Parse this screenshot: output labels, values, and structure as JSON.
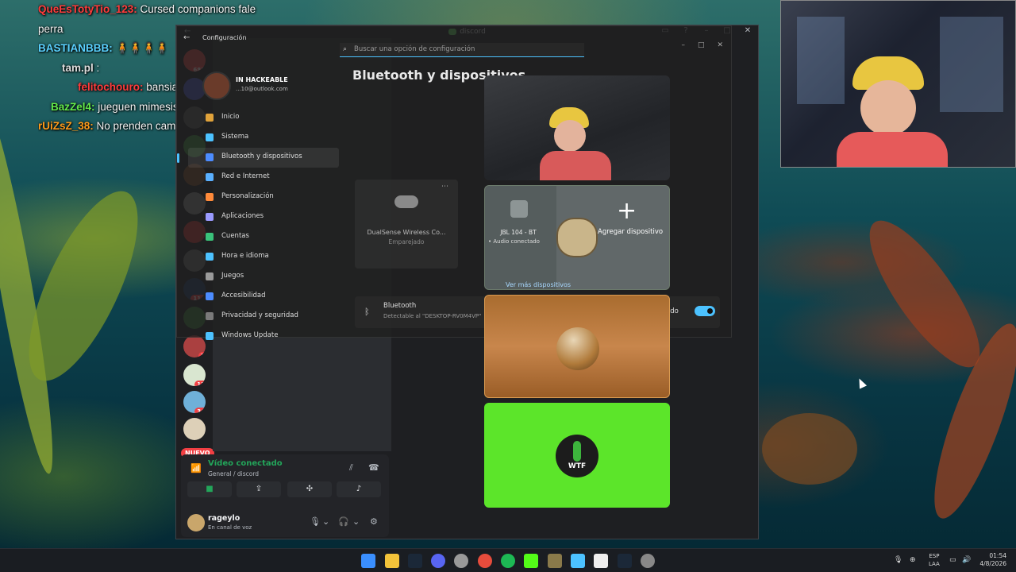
{
  "stream_chat": [
    {
      "user": "QueEsTotyTio_123:",
      "text": " Cursed companions fale",
      "color": "#ff3b3b"
    },
    {
      "user": "",
      "text": "perra",
      "color": "#ffffff"
    },
    {
      "user": "BASTIANBBB:",
      "text": " 🧍🧍🧍🧍",
      "color": "#5ad1ff"
    },
    {
      "user": "tam.pl",
      "text": " :",
      "color": "#ffffff"
    },
    {
      "user": "felitochouro:",
      "text": " bansiaaann",
      "color": "#ff3b3b"
    },
    {
      "user": "BazZel4:",
      "text": " jueguen mimesis",
      "color": "#63e94a"
    },
    {
      "user": "rUiZsZ_38:",
      "text": " No prenden cam",
      "color": "#ff9a1a"
    }
  ],
  "discord": {
    "title": "discord",
    "guild_badges": [
      "683",
      "114",
      "2",
      "11",
      "34"
    ],
    "new_badge": "NUEVO",
    "voice_status": {
      "title": "Vídeo conectado",
      "subtitle": "General / discord"
    },
    "user": {
      "name": "rageylo",
      "status": "En canal de voz"
    }
  },
  "settings": {
    "header": "Configuración",
    "search_placeholder": "Buscar una opción de configuración",
    "profile_name": "IN HACKEABLE",
    "profile_email": "...10@outlook.com",
    "nav": [
      {
        "label": "Inicio",
        "color": "#e0a23a"
      },
      {
        "label": "Sistema",
        "color": "#4cc2ff"
      },
      {
        "label": "Bluetooth y dispositivos",
        "color": "#4c8cff",
        "active": true
      },
      {
        "label": "Red e Internet",
        "color": "#5ab0ff"
      },
      {
        "label": "Personalización",
        "color": "#ff8a3a"
      },
      {
        "label": "Aplicaciones",
        "color": "#9a9aff"
      },
      {
        "label": "Cuentas",
        "color": "#3ac27a"
      },
      {
        "label": "Hora e idioma",
        "color": "#4cc2ff"
      },
      {
        "label": "Juegos",
        "color": "#9a9a9a"
      },
      {
        "label": "Accesibilidad",
        "color": "#4c8cff"
      },
      {
        "label": "Privacidad y seguridad",
        "color": "#7a7a7a"
      },
      {
        "label": "Windows Update",
        "color": "#4cc2ff"
      }
    ],
    "page_title": "Bluetooth y dispositivos",
    "device_card": {
      "name": "DualSense Wireless Co...",
      "status": "Emparejado"
    },
    "bluetooth": {
      "label": "Bluetooth",
      "description": "Detectable al \"DESKTOP-RV0M4VP\"",
      "state": "Activado",
      "enabled": true
    }
  },
  "voice_tiles": {
    "jbl_name": "JBL 104 - BT",
    "jbl_status": "• Audio conectado",
    "add_device": "Agregar dispositivo",
    "more_devices": "Ver más dispositivos",
    "wtf_label": "WTF"
  },
  "taskbar": {
    "lang": "ESP",
    "layout": "LAA",
    "time": "01:54",
    "date": "4/8/2026"
  }
}
